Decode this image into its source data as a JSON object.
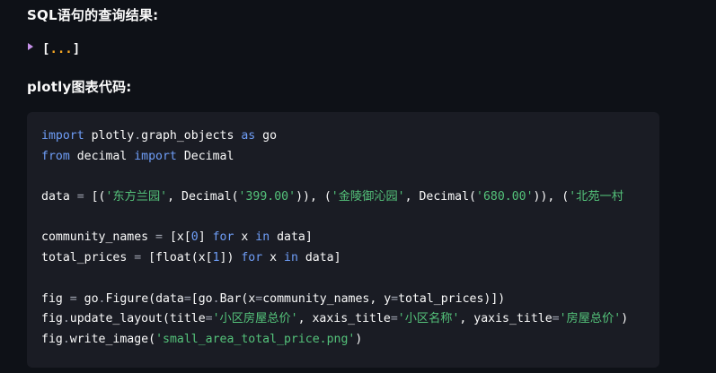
{
  "headings": {
    "sql_result": "SQL语句的查询结果:",
    "plotly_code": "plotly图表代码:"
  },
  "json_viewer": {
    "open_bracket": "[",
    "ellipsis": "...",
    "close_bracket": "]"
  },
  "colors": {
    "background": "#0e1117",
    "code_background": "#1a1c24",
    "keyword": "#6f9ef8",
    "string": "#54c27a",
    "caret": "#c792ea",
    "ellipsis": "#f5a623"
  },
  "code_lines": [
    [
      {
        "t": "import",
        "c": "kw"
      },
      {
        "t": " plotly",
        "c": "pl"
      },
      {
        "t": ".",
        "c": "op"
      },
      {
        "t": "graph_objects ",
        "c": "pl"
      },
      {
        "t": "as",
        "c": "kw"
      },
      {
        "t": " go",
        "c": "pl"
      }
    ],
    [
      {
        "t": "from",
        "c": "kw"
      },
      {
        "t": " decimal ",
        "c": "pl"
      },
      {
        "t": "import",
        "c": "kw"
      },
      {
        "t": " Decimal",
        "c": "pl"
      }
    ],
    [],
    [
      {
        "t": "data ",
        "c": "pl"
      },
      {
        "t": "=",
        "c": "op"
      },
      {
        "t": " [(",
        "c": "pl"
      },
      {
        "t": "'东方兰园'",
        "c": "str"
      },
      {
        "t": ", Decimal(",
        "c": "pl"
      },
      {
        "t": "'399.00'",
        "c": "str"
      },
      {
        "t": ")), (",
        "c": "pl"
      },
      {
        "t": "'金陵御沁园'",
        "c": "str"
      },
      {
        "t": ", Decimal(",
        "c": "pl"
      },
      {
        "t": "'680.00'",
        "c": "str"
      },
      {
        "t": ")), (",
        "c": "pl"
      },
      {
        "t": "'北苑一村",
        "c": "str"
      }
    ],
    [],
    [
      {
        "t": "community_names ",
        "c": "pl"
      },
      {
        "t": "=",
        "c": "op"
      },
      {
        "t": " [x[",
        "c": "pl"
      },
      {
        "t": "0",
        "c": "num"
      },
      {
        "t": "] ",
        "c": "pl"
      },
      {
        "t": "for",
        "c": "kw"
      },
      {
        "t": " x ",
        "c": "pl"
      },
      {
        "t": "in",
        "c": "kw"
      },
      {
        "t": " data]",
        "c": "pl"
      }
    ],
    [
      {
        "t": "total_prices ",
        "c": "pl"
      },
      {
        "t": "=",
        "c": "op"
      },
      {
        "t": " [float(x[",
        "c": "pl"
      },
      {
        "t": "1",
        "c": "num"
      },
      {
        "t": "]) ",
        "c": "pl"
      },
      {
        "t": "for",
        "c": "kw"
      },
      {
        "t": " x ",
        "c": "pl"
      },
      {
        "t": "in",
        "c": "kw"
      },
      {
        "t": " data]",
        "c": "pl"
      }
    ],
    [],
    [
      {
        "t": "fig ",
        "c": "pl"
      },
      {
        "t": "=",
        "c": "op"
      },
      {
        "t": " go",
        "c": "pl"
      },
      {
        "t": ".",
        "c": "op"
      },
      {
        "t": "Figure(data",
        "c": "pl"
      },
      {
        "t": "=",
        "c": "op"
      },
      {
        "t": "[go",
        "c": "pl"
      },
      {
        "t": ".",
        "c": "op"
      },
      {
        "t": "Bar(x",
        "c": "pl"
      },
      {
        "t": "=",
        "c": "op"
      },
      {
        "t": "community_names, y",
        "c": "pl"
      },
      {
        "t": "=",
        "c": "op"
      },
      {
        "t": "total_prices)])",
        "c": "pl"
      }
    ],
    [
      {
        "t": "fig",
        "c": "pl"
      },
      {
        "t": ".",
        "c": "op"
      },
      {
        "t": "update_layout(title",
        "c": "pl"
      },
      {
        "t": "=",
        "c": "op"
      },
      {
        "t": "'小区房屋总价'",
        "c": "str"
      },
      {
        "t": ", xaxis_title",
        "c": "pl"
      },
      {
        "t": "=",
        "c": "op"
      },
      {
        "t": "'小区名称'",
        "c": "str"
      },
      {
        "t": ", yaxis_title",
        "c": "pl"
      },
      {
        "t": "=",
        "c": "op"
      },
      {
        "t": "'房屋总价'",
        "c": "str"
      },
      {
        "t": ")",
        "c": "pl"
      }
    ],
    [
      {
        "t": "fig",
        "c": "pl"
      },
      {
        "t": ".",
        "c": "op"
      },
      {
        "t": "write_image(",
        "c": "pl"
      },
      {
        "t": "'small_area_total_price.png'",
        "c": "str"
      },
      {
        "t": ")",
        "c": "pl"
      }
    ]
  ]
}
